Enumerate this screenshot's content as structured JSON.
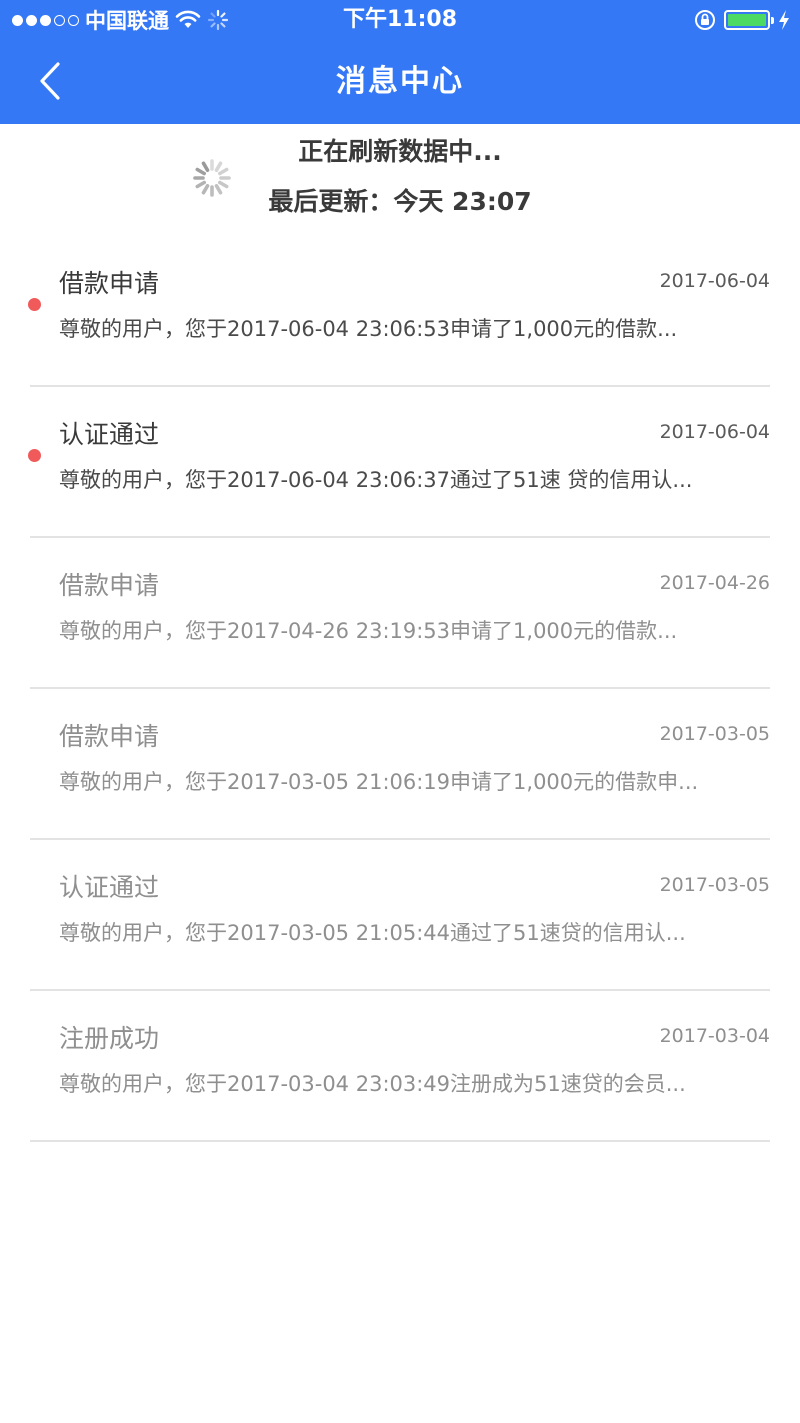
{
  "status_bar": {
    "carrier": "中国联通",
    "time": "下午11:08",
    "signal_icon": "signal-dots-icon",
    "wifi_icon": "wifi-icon",
    "activity_icon": "activity-spinner-icon",
    "orientation_lock_icon": "orientation-lock-icon",
    "battery_icon": "battery-icon",
    "charging_icon": "charging-bolt-icon",
    "battery_level": 1.0,
    "colors": {
      "battery": "#4cd964"
    }
  },
  "nav": {
    "title": "消息中心",
    "back_icon": "chevron-left-icon",
    "colors": {
      "background": "#3478f6",
      "text": "#ffffff"
    }
  },
  "refresh": {
    "status": "正在刷新数据中...",
    "last_updated": "最后更新：今天 23:07",
    "spinner_icon": "loading-spinner-icon"
  },
  "messages": [
    {
      "title": "借款申请",
      "date": "2017-06-04",
      "preview": "尊敬的用户，您于2017-06-04 23:06:53申请了1,000元的借款...",
      "unread": true
    },
    {
      "title": "认证通过",
      "date": "2017-06-04",
      "preview": "尊敬的用户，您于2017-06-04 23:06:37通过了51速 贷的信用认...",
      "unread": true
    },
    {
      "title": "借款申请",
      "date": "2017-04-26",
      "preview": "尊敬的用户，您于2017-04-26 23:19:53申请了1,000元的借款...",
      "unread": false
    },
    {
      "title": "借款申请",
      "date": "2017-03-05",
      "preview": "尊敬的用户，您于2017-03-05 21:06:19申请了1,000元的借款申...",
      "unread": false
    },
    {
      "title": "认证通过",
      "date": "2017-03-05",
      "preview": "尊敬的用户，您于2017-03-05 21:05:44通过了51速贷的信用认...",
      "unread": false
    },
    {
      "title": "注册成功",
      "date": "2017-03-04",
      "preview": "尊敬的用户，您于2017-03-04 23:03:49注册成为51速贷的会员...",
      "unread": false
    }
  ],
  "colors": {
    "unread_dot": "#f05a5a",
    "divider": "#e3e3e3",
    "unread_text": "#3a3a3a",
    "read_text": "#8f8f8f"
  }
}
